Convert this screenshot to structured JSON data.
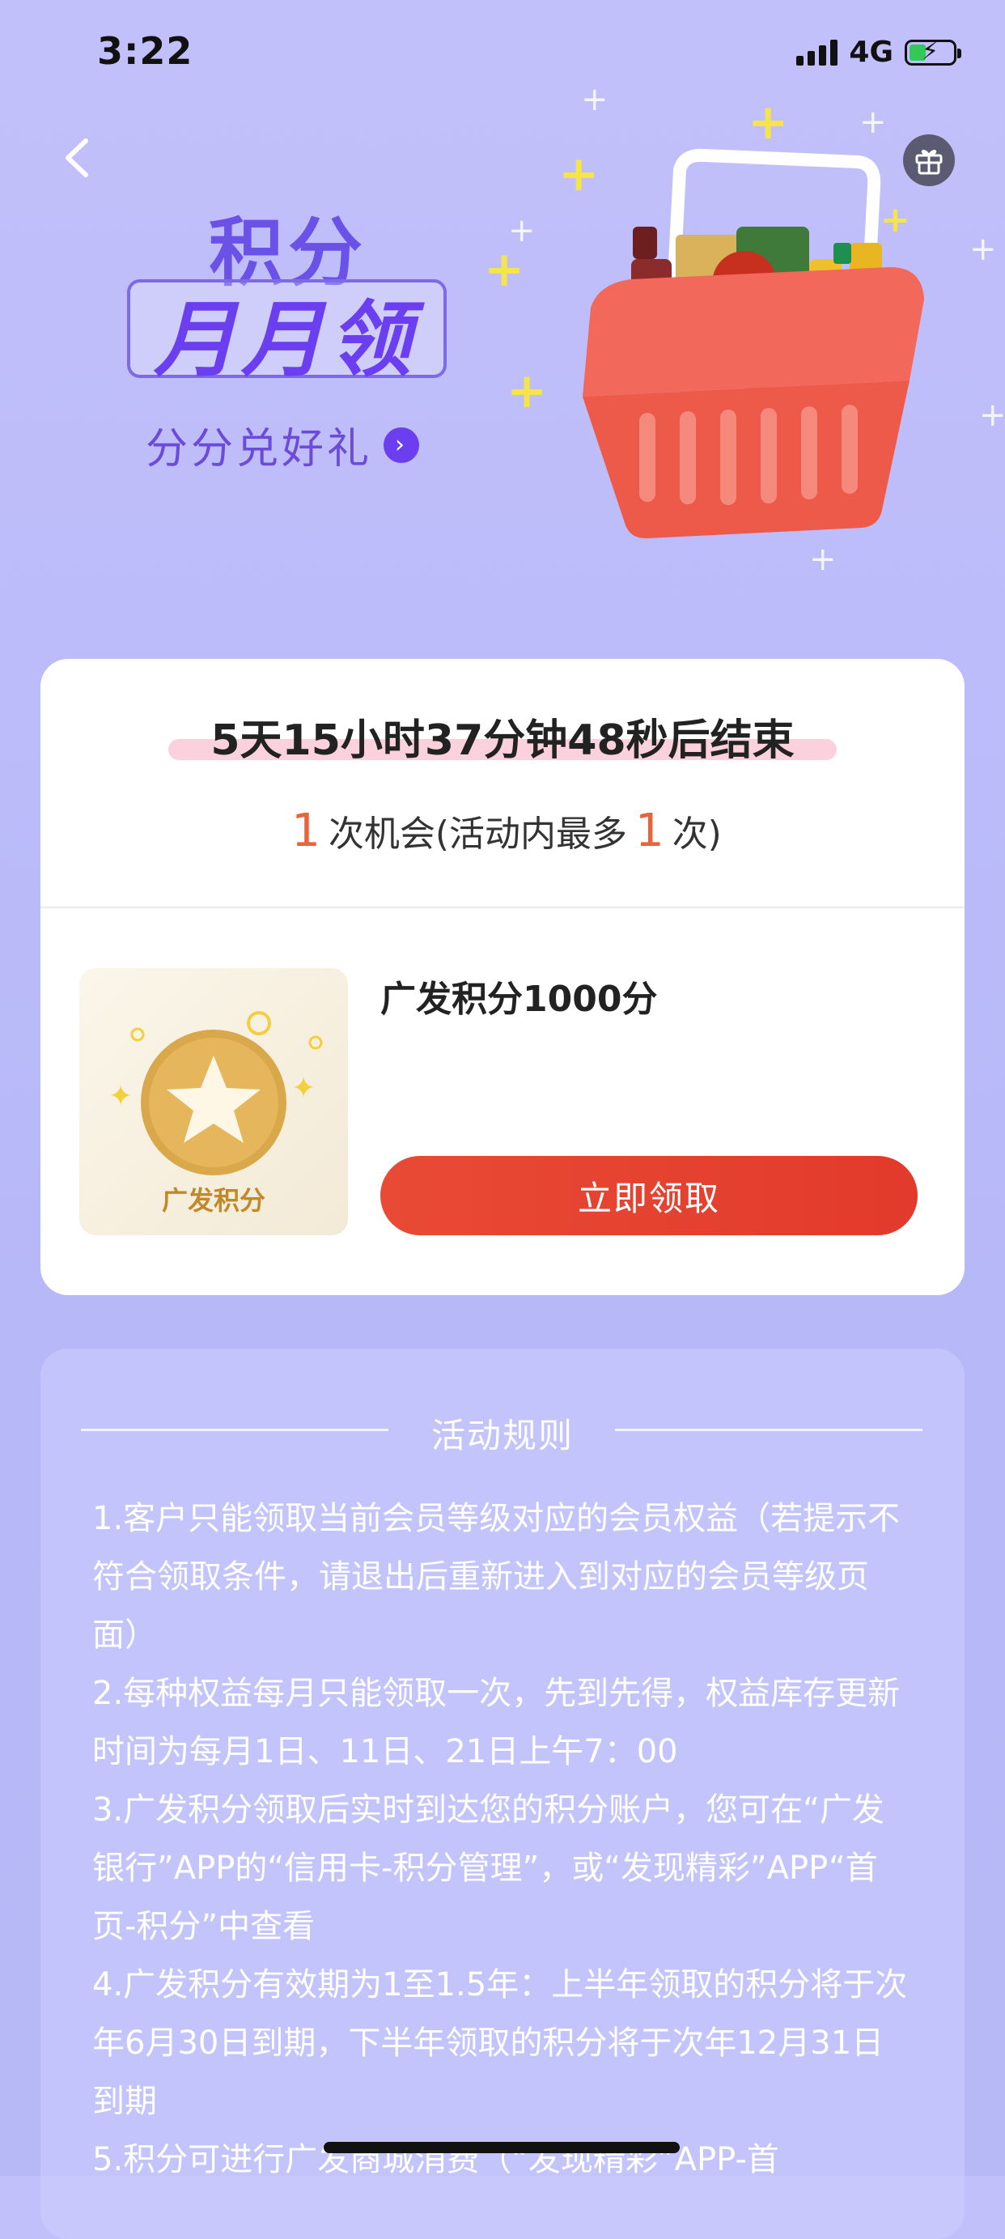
{
  "status_bar": {
    "time": "3:22",
    "network": "4G"
  },
  "banner": {
    "title_line1": "积分",
    "title_line2": "月月领",
    "subtitle": "分分兑好礼"
  },
  "activity": {
    "countdown": "5天15小时37分钟48秒后结束",
    "chances_count": "1",
    "chances_text": "次机会(活动内最多",
    "max_count": "1",
    "chances_suffix": "次)"
  },
  "prize": {
    "name": "广发积分1000分",
    "thumb_label": "广发积分",
    "button_label": "立即领取"
  },
  "rules": {
    "title": "活动规则",
    "items": [
      "1.客户只能领取当前会员等级对应的会员权益（若提示不符合领取条件，请退出后重新进入到对应的会员等级页面）",
      "2.每种权益每月只能领取一次，先到先得，权益库存更新时间为每月1日、11日、21日上午7：00",
      "3.广发积分领取后实时到达您的积分账户，您可在“广发银行”APP的“信用卡-积分管理”，或“发现精彩”APP“首页-积分”中查看",
      "4.广发积分有效期为1至1.5年：上半年领取的积分将于次年6月30日到期，下半年领取的积分将于次年12月31日到期",
      "5.积分可进行广发商城消费（“发现精彩”APP-首"
    ]
  },
  "icons": [
    "chevron-left-icon",
    "gift-icon",
    "signal-icon",
    "battery-icon",
    "star-coin-icon",
    "chevron-right-icon"
  ],
  "colors": {
    "accent": "#6b3ff0",
    "button": "#e23a2c",
    "count": "#e8643a",
    "background": "#bcbcfa"
  }
}
